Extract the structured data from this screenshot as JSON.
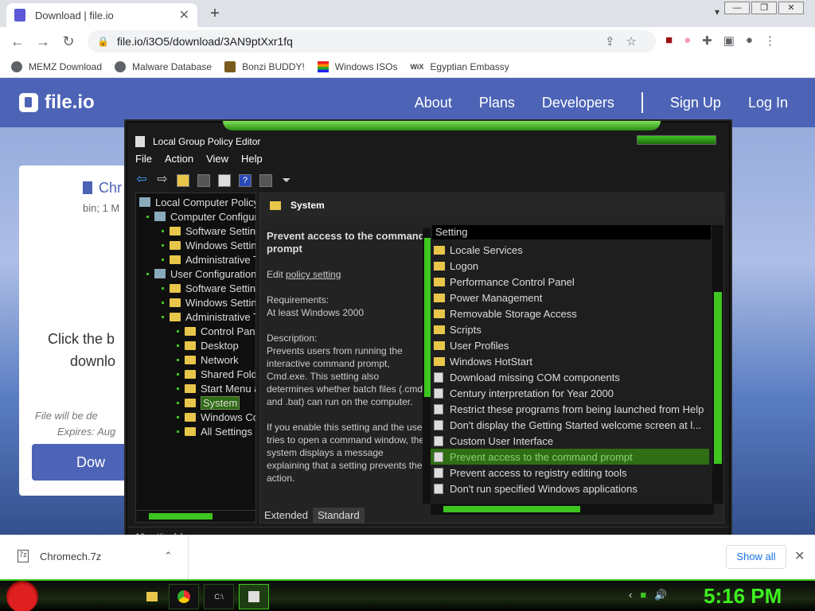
{
  "browser": {
    "tab_title": "Download | file.io",
    "url": "file.io/i3O5/download/3AN9ptXxr1fq",
    "bookmarks": [
      "MEMZ Download",
      "Malware Database",
      "Bonzi BUDDY!",
      "Windows ISOs",
      "Egyptian Embassy"
    ]
  },
  "site": {
    "logo": "file.io",
    "nav": [
      "About",
      "Plans",
      "Developers",
      "Sign Up",
      "Log In"
    ],
    "file_name": "Chr",
    "file_info": "bin; 1 M",
    "click_line1": "Click the b",
    "click_line2": "downlo",
    "warn1": "File will be de",
    "warn2": "Expires: Aug",
    "download_btn": "Dow"
  },
  "gpedit": {
    "title": "Local Group Policy Editor",
    "menu": [
      "File",
      "Action",
      "View",
      "Help"
    ],
    "tree": [
      {
        "label": "Local Computer Policy",
        "level": 0
      },
      {
        "label": "Computer Configura",
        "level": 1
      },
      {
        "label": "Software Settin",
        "level": 2
      },
      {
        "label": "Windows Settin",
        "level": 2
      },
      {
        "label": "Administrative T",
        "level": 2
      },
      {
        "label": "User Configuration",
        "level": 1
      },
      {
        "label": "Software Settin",
        "level": 2
      },
      {
        "label": "Windows Settin",
        "level": 2
      },
      {
        "label": "Administrative T",
        "level": 2
      },
      {
        "label": "Control Pane",
        "level": 3
      },
      {
        "label": "Desktop",
        "level": 3
      },
      {
        "label": "Network",
        "level": 3
      },
      {
        "label": "Shared Fold",
        "level": 3
      },
      {
        "label": "Start Menu a",
        "level": 3
      },
      {
        "label": "System",
        "level": 3,
        "selected": true
      },
      {
        "label": "Windows Co",
        "level": 3
      },
      {
        "label": "All Settings",
        "level": 3
      }
    ],
    "right_header": "System",
    "desc": {
      "title": "Prevent access to the command prompt",
      "edit": "Edit",
      "edit_link": "policy setting",
      "req_label": "Requirements:",
      "req_value": "At least Windows 2000",
      "desc_label": "Description:",
      "desc_text": "Prevents users from running the interactive command prompt, Cmd.exe. This setting also determines whether batch files (.cmd and .bat) can run on the computer.",
      "desc_text2": "If you enable this setting and the user tries to open a command window, the system displays a message explaining that a setting prevents the action."
    },
    "list_header": "Setting",
    "list": [
      {
        "label": "Locale Services",
        "type": "folder"
      },
      {
        "label": "Logon",
        "type": "folder"
      },
      {
        "label": "Performance Control Panel",
        "type": "folder"
      },
      {
        "label": "Power Management",
        "type": "folder"
      },
      {
        "label": "Removable Storage Access",
        "type": "folder"
      },
      {
        "label": "Scripts",
        "type": "folder"
      },
      {
        "label": "User Profiles",
        "type": "folder"
      },
      {
        "label": "Windows HotStart",
        "type": "folder"
      },
      {
        "label": "Download missing COM components",
        "type": "policy"
      },
      {
        "label": "Century interpretation for Year 2000",
        "type": "policy"
      },
      {
        "label": "Restrict these programs from being launched from Help",
        "type": "policy"
      },
      {
        "label": "Don't display the Getting Started welcome screen at l...",
        "type": "policy"
      },
      {
        "label": "Custom User Interface",
        "type": "policy"
      },
      {
        "label": "Prevent access to the command prompt",
        "type": "policy",
        "selected": true
      },
      {
        "label": "Prevent access to registry editing tools",
        "type": "policy"
      },
      {
        "label": "Don't run specified Windows applications",
        "type": "policy"
      }
    ],
    "tabs": [
      "Extended",
      "Standard"
    ],
    "status": "10 setting(s)"
  },
  "downloads": {
    "file": "Chromech.7z",
    "show_all": "Show all"
  },
  "taskbar": {
    "clock": "5:16 PM"
  }
}
